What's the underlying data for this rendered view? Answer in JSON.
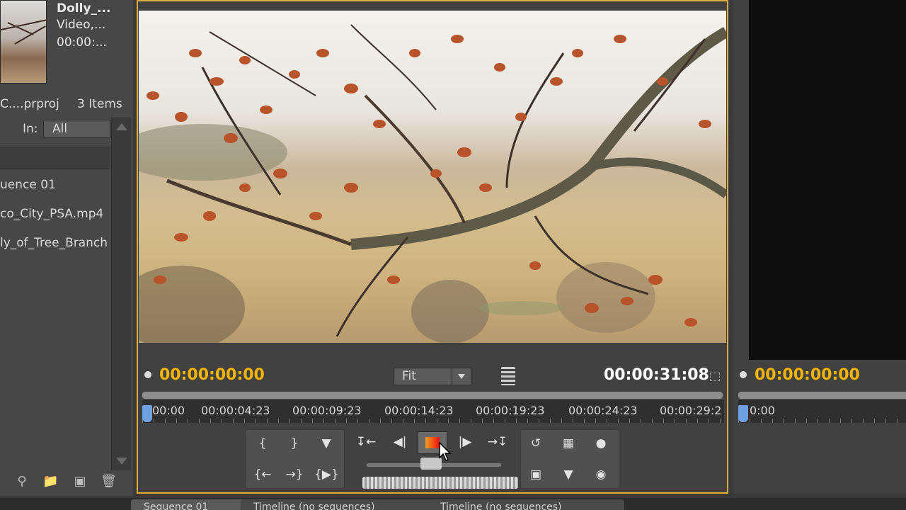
{
  "project_panel": {
    "clip": {
      "name": "Dolly_...",
      "type": "Video,...",
      "duration": "00:00:..."
    },
    "project_name": "C....prproj",
    "item_count": "3 Items",
    "in_label": "In:",
    "in_value": "All",
    "items": [
      {
        "label": "uence 01"
      },
      {
        "label": "co_City_PSA.mp4"
      },
      {
        "label": "ly_of_Tree_Branch"
      }
    ]
  },
  "program_monitor": {
    "timecode": "00:00:00:00",
    "duration": "00:00:31:08",
    "zoom": "Fit",
    "ruler_labels": [
      "00:00",
      "00:00:04:23",
      "00:00:09:23",
      "00:00:14:23",
      "00:00:19:23",
      "00:00:24:23",
      "00:00:29:2"
    ],
    "playing": true
  },
  "source_monitor": {
    "timecode": "00:00:00:00",
    "ruler_label": "0:00"
  },
  "tabs": [
    {
      "label": "Sequence 01"
    },
    {
      "label": "Timeline (no sequences)"
    },
    {
      "label": "Timeline (no sequences)"
    }
  ],
  "colors": {
    "accent_timecode": "#f2b400",
    "panel_focus_border": "#e2a93b",
    "playhead": "#6fa0e0"
  },
  "icons": {
    "transport": [
      "mark-in-icon",
      "mark-out-icon",
      "add-marker-icon",
      "go-to-in-icon",
      "step-back-icon",
      "stop-icon",
      "step-forward-icon",
      "go-to-out-icon",
      "loop-icon",
      "safe-margins-icon",
      "output-icon",
      "lift-icon",
      "extract-icon",
      "export-frame-icon"
    ]
  }
}
